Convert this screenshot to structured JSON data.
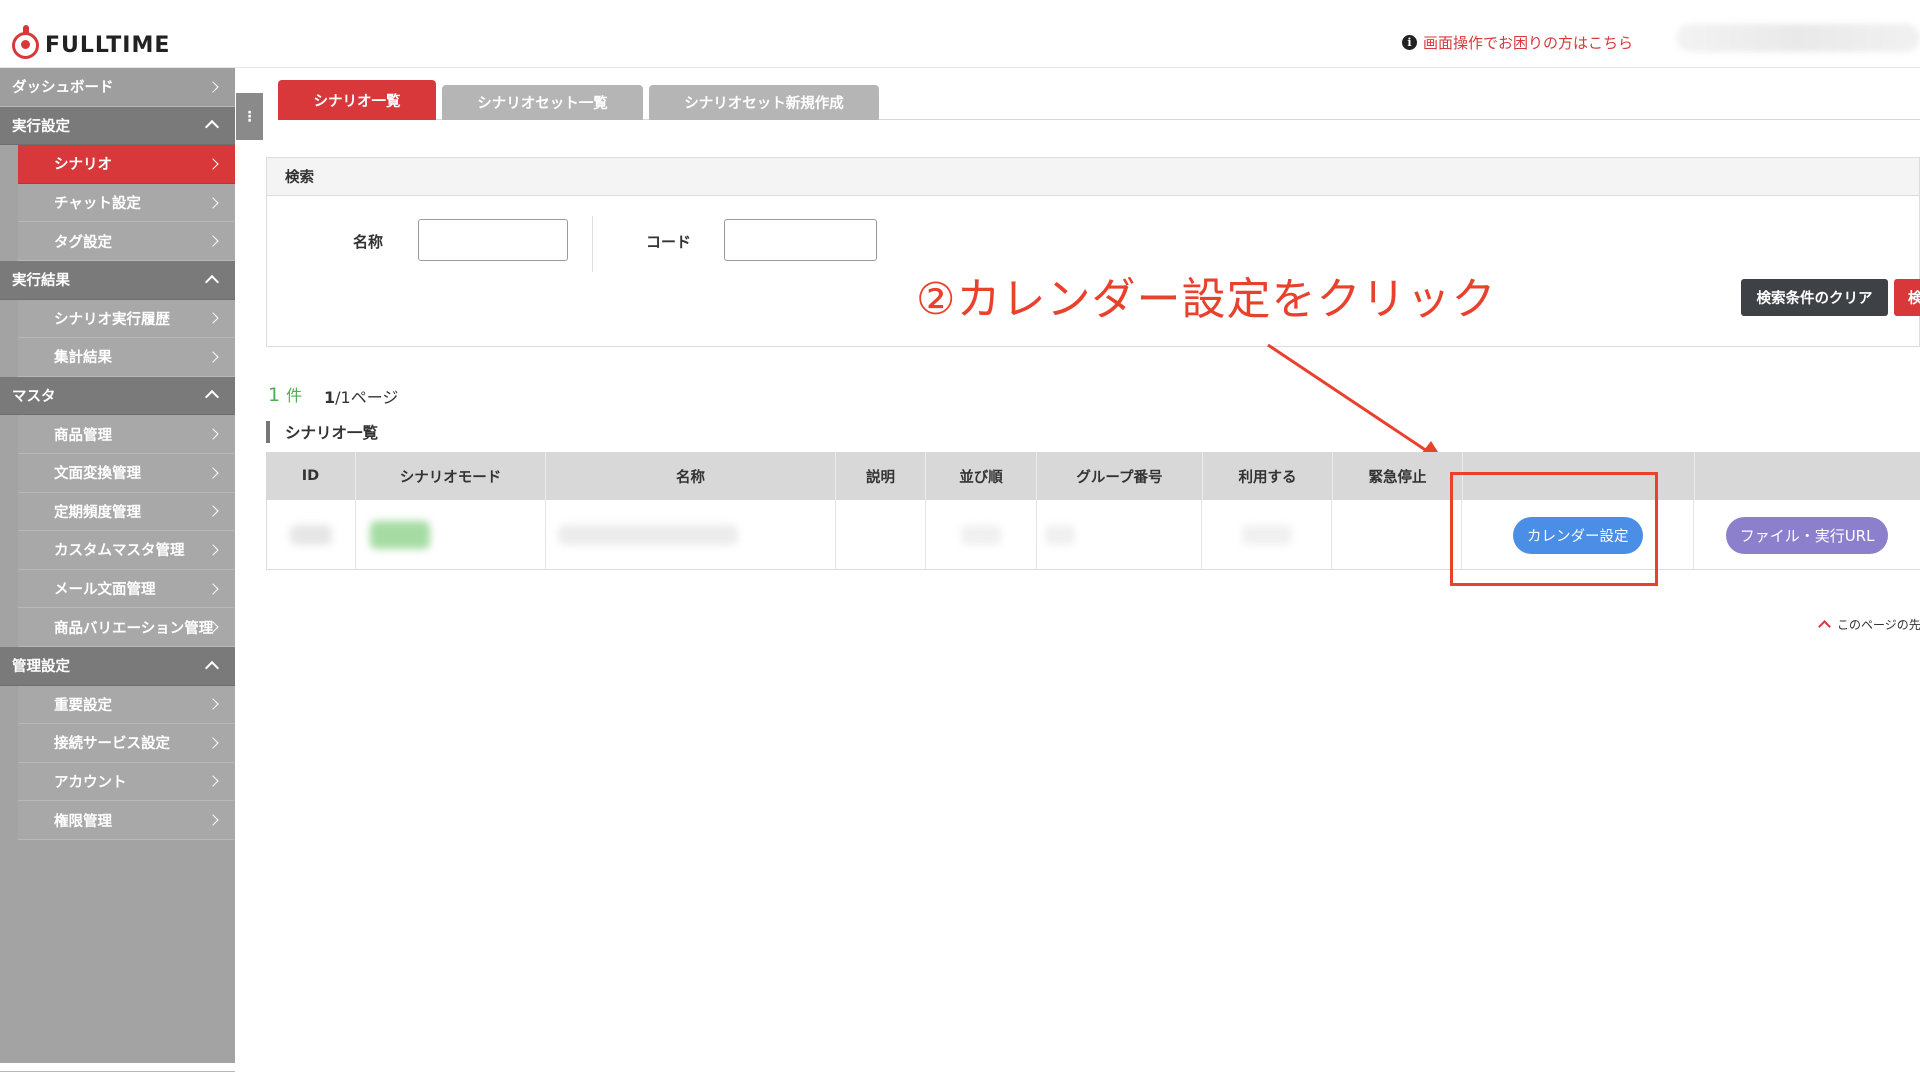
{
  "header": {
    "logo_text": "FULLTIME",
    "help_link": "画面操作でお困りの方はこちら"
  },
  "sidebar": {
    "items": [
      {
        "label": "ダッシュボード",
        "kind": "top"
      },
      {
        "label": "実行設定",
        "kind": "section"
      },
      {
        "label": "シナリオ",
        "kind": "sub",
        "active": true
      },
      {
        "label": "チャット設定",
        "kind": "sub"
      },
      {
        "label": "タグ設定",
        "kind": "sub"
      },
      {
        "label": "実行結果",
        "kind": "section"
      },
      {
        "label": "シナリオ実行履歴",
        "kind": "sub"
      },
      {
        "label": "集計結果",
        "kind": "sub"
      },
      {
        "label": "マスタ",
        "kind": "section"
      },
      {
        "label": "商品管理",
        "kind": "sub"
      },
      {
        "label": "文面変換管理",
        "kind": "sub"
      },
      {
        "label": "定期頻度管理",
        "kind": "sub"
      },
      {
        "label": "カスタムマスタ管理",
        "kind": "sub"
      },
      {
        "label": "メール文面管理",
        "kind": "sub"
      },
      {
        "label": "商品バリエーション管理",
        "kind": "sub"
      },
      {
        "label": "管理設定",
        "kind": "section"
      },
      {
        "label": "重要設定",
        "kind": "sub"
      },
      {
        "label": "接続サービス設定",
        "kind": "sub"
      },
      {
        "label": "アカウント",
        "kind": "sub"
      },
      {
        "label": "権限管理",
        "kind": "sub"
      }
    ],
    "toggle_glyph": "⋮"
  },
  "tabs": [
    {
      "label": "シナリオ一覧",
      "active": true
    },
    {
      "label": "シナリオセット一覧",
      "active": false
    },
    {
      "label": "シナリオセット新規作成",
      "active": false
    }
  ],
  "search": {
    "title": "検索",
    "name_label": "名称",
    "name_value": "",
    "code_label": "コード",
    "code_value": "",
    "clear_button": "検索条件のクリア",
    "search_button": "検"
  },
  "annotation": {
    "text": "②カレンダー設定をクリック",
    "color": "#e8412c"
  },
  "results": {
    "count": "1",
    "count_unit": "件",
    "page_current": "1",
    "page_rest": "/1ページ"
  },
  "list_title": "シナリオ一覧",
  "table": {
    "columns": [
      "ID",
      "シナリオモード",
      "名称",
      "説明",
      "並び順",
      "グループ番号",
      "利用する",
      "緊急停止",
      "",
      ""
    ],
    "row": {
      "calendar_button": "カレンダー設定",
      "file_button": "ファイル・実行URL"
    }
  },
  "page_top": "このページの先",
  "colors": {
    "accent": "#d9383a",
    "calendar_button": "#4a8ee6",
    "file_button": "#8c7fcb",
    "count_green": "#4caf50"
  }
}
